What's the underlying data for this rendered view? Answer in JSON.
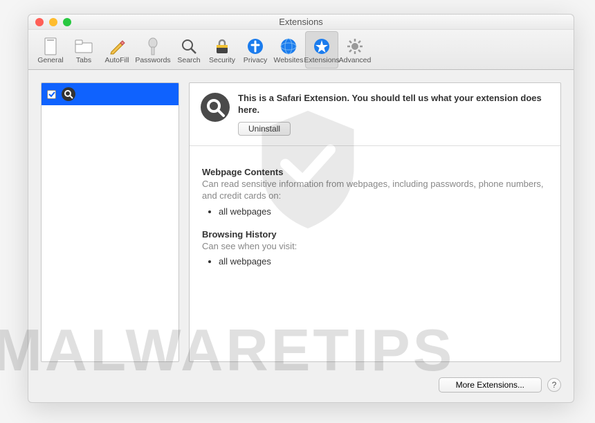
{
  "window": {
    "title": "Extensions"
  },
  "toolbar": {
    "items": [
      {
        "label": "General"
      },
      {
        "label": "Tabs"
      },
      {
        "label": "AutoFill"
      },
      {
        "label": "Passwords"
      },
      {
        "label": "Search"
      },
      {
        "label": "Security"
      },
      {
        "label": "Privacy"
      },
      {
        "label": "Websites"
      },
      {
        "label": "Extensions"
      },
      {
        "label": "Advanced"
      }
    ]
  },
  "extension": {
    "description": "This is a Safari Extension. You should tell us what your extension does here.",
    "uninstall_label": "Uninstall",
    "permissions": {
      "webpage_title": "Webpage Contents",
      "webpage_sub": "Can read sensitive information from webpages, including passwords, phone numbers, and credit cards on:",
      "webpage_item": "all webpages",
      "history_title": "Browsing History",
      "history_sub": "Can see when you visit:",
      "history_item": "all webpages"
    }
  },
  "footer": {
    "more_label": "More Extensions...",
    "help_label": "?"
  },
  "watermark": "MALWARETIPS"
}
